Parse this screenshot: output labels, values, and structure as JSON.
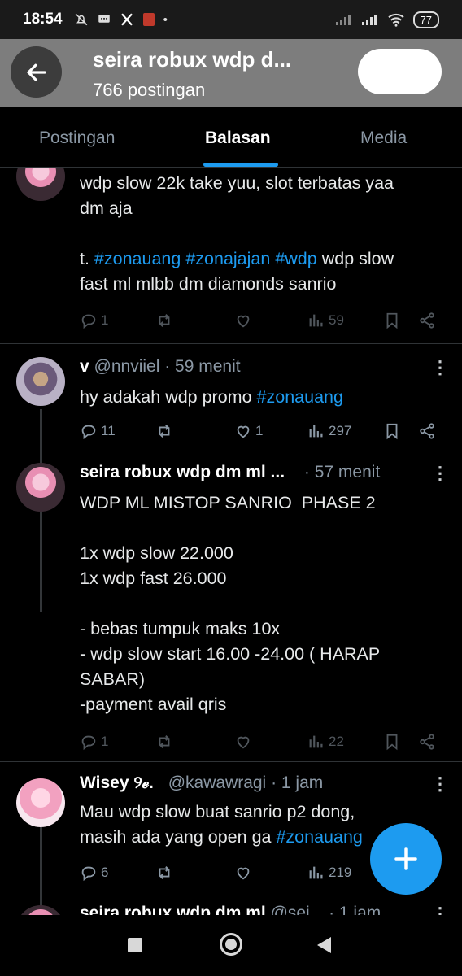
{
  "status_bar": {
    "time": "18:54",
    "battery": "77"
  },
  "header": {
    "title": "seira robux wdp d...",
    "post_count": "766 postingan"
  },
  "tabs": [
    {
      "label": "Postingan"
    },
    {
      "label": "Balasan"
    },
    {
      "label": "Media"
    }
  ],
  "posts": [
    {
      "text_line1": "wdp slow 22k take yuu, slot terbatas yaa",
      "text_line2": "dm aja",
      "text_tag_prefix": "t. ",
      "tags": [
        "#zonauang",
        "#zonajajan",
        "#wdp"
      ],
      "text_tail1": " wdp slow",
      "text_tail2": "fast ml mlbb dm diamonds sanrio",
      "replies": "1",
      "retweets": "",
      "likes": "",
      "views": "59"
    },
    {
      "name": "v",
      "handle": "@nnviiel",
      "time": "· 59 menit",
      "text": "hy adakah wdp promo ",
      "tag": "#zonauang",
      "replies": "11",
      "retweets": "",
      "likes": "1",
      "views": "297"
    },
    {
      "name": "seira robux wdp dm ml ...",
      "time": "· 57 menit",
      "text": "WDP ML MISTOP SANRIO  PHASE 2\n\n1x wdp slow 22.000\n1x wdp fast 26.000\n\n- bebas tumpuk maks 10x\n- wdp slow start 16.00 -24.00 ( HARAP\nSABAR)\n-payment avail qris",
      "replies": "1",
      "retweets": "",
      "likes": "",
      "views": "22"
    },
    {
      "name": "Wisey ୨ℯ.",
      "handle": "@kawawragi",
      "time": "· 1 jam",
      "text_line1": "Mau wdp slow buat sanrio p2 dong,",
      "text_line2": "masih ada yang open ga ",
      "tag": "#zonauang",
      "replies": "6",
      "retweets": "",
      "likes": "",
      "views": "219"
    },
    {
      "name": "seira robux wdp dm ml",
      "handle": "@sei...",
      "time": "· 1 jam"
    }
  ],
  "colors": {
    "accent": "#1d9bf0",
    "background": "#000000",
    "header_band": "#7d7d7d"
  }
}
